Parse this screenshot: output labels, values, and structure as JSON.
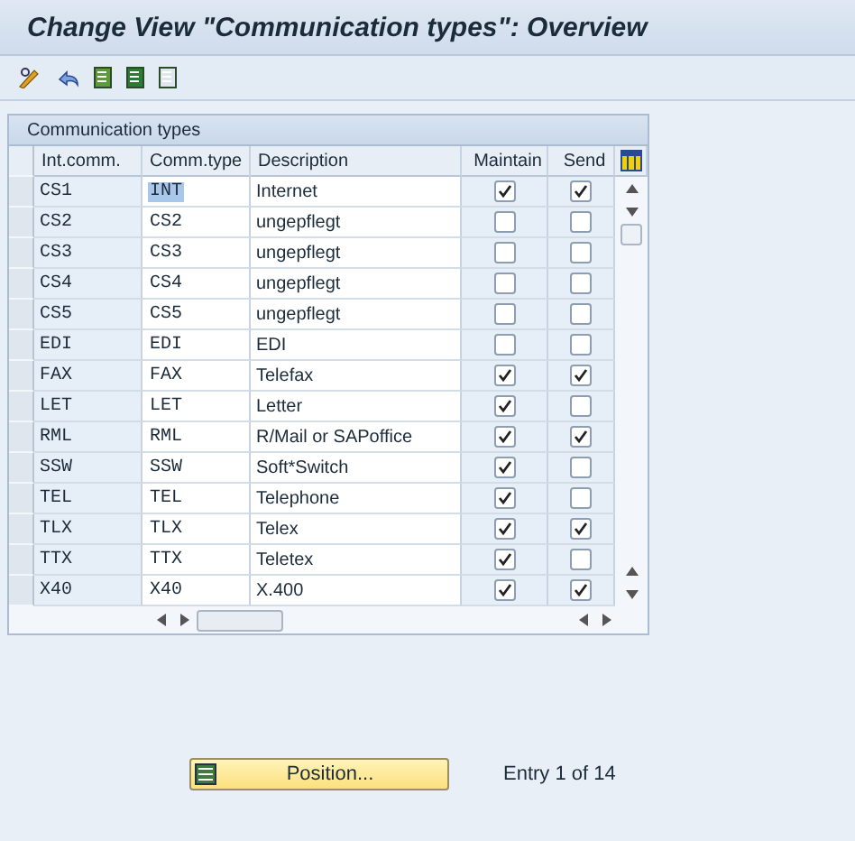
{
  "window": {
    "title": "Change View \"Communication types\": Overview"
  },
  "table": {
    "title": "Communication types",
    "columns": [
      "Int.comm.",
      "Comm.type",
      "Description",
      "Maintain",
      "Send"
    ],
    "rows": [
      {
        "int_comm": "CS1",
        "comm_type": "INT",
        "comm_type_selected": true,
        "description": "Internet",
        "maintain": true,
        "send": true
      },
      {
        "int_comm": "CS2",
        "comm_type": "CS2",
        "comm_type_selected": false,
        "description": "ungepflegt",
        "maintain": false,
        "send": false
      },
      {
        "int_comm": "CS3",
        "comm_type": "CS3",
        "comm_type_selected": false,
        "description": "ungepflegt",
        "maintain": false,
        "send": false
      },
      {
        "int_comm": "CS4",
        "comm_type": "CS4",
        "comm_type_selected": false,
        "description": "ungepflegt",
        "maintain": false,
        "send": false
      },
      {
        "int_comm": "CS5",
        "comm_type": "CS5",
        "comm_type_selected": false,
        "description": "ungepflegt",
        "maintain": false,
        "send": false
      },
      {
        "int_comm": "EDI",
        "comm_type": "EDI",
        "comm_type_selected": false,
        "description": "EDI",
        "maintain": false,
        "send": false
      },
      {
        "int_comm": "FAX",
        "comm_type": "FAX",
        "comm_type_selected": false,
        "description": "Telefax",
        "maintain": true,
        "send": true
      },
      {
        "int_comm": "LET",
        "comm_type": "LET",
        "comm_type_selected": false,
        "description": "Letter",
        "maintain": true,
        "send": false
      },
      {
        "int_comm": "RML",
        "comm_type": "RML",
        "comm_type_selected": false,
        "description": "R/Mail or SAPoffice",
        "maintain": true,
        "send": true
      },
      {
        "int_comm": "SSW",
        "comm_type": "SSW",
        "comm_type_selected": false,
        "description": "Soft*Switch",
        "maintain": true,
        "send": false
      },
      {
        "int_comm": "TEL",
        "comm_type": "TEL",
        "comm_type_selected": false,
        "description": "Telephone",
        "maintain": true,
        "send": false
      },
      {
        "int_comm": "TLX",
        "comm_type": "TLX",
        "comm_type_selected": false,
        "description": "Telex",
        "maintain": true,
        "send": true
      },
      {
        "int_comm": "TTX",
        "comm_type": "TTX",
        "comm_type_selected": false,
        "description": "Teletex",
        "maintain": true,
        "send": false
      },
      {
        "int_comm": "X40",
        "comm_type": "X40",
        "comm_type_selected": false,
        "description": "X.400",
        "maintain": true,
        "send": true
      }
    ]
  },
  "position_button": "Position...",
  "entry_info": "Entry 1 of 14"
}
